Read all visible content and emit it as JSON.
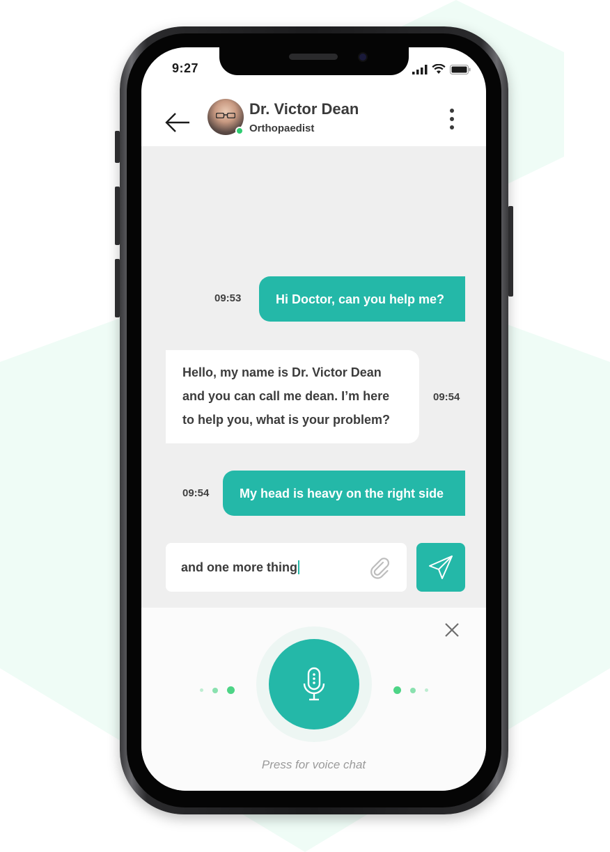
{
  "status_bar": {
    "time": "9:27"
  },
  "header": {
    "doctor_name": "Dr. Victor Dean",
    "doctor_role": "Orthopaedist",
    "online": true
  },
  "messages": [
    {
      "direction": "out",
      "text": "Hi Doctor, can you help me?",
      "time": "09:53"
    },
    {
      "direction": "in",
      "lines": [
        "Hello, my name is Dr. Victor Dean",
        "and you can call me dean. I’m here",
        "to help you, what is your problem?"
      ],
      "time": "09:54"
    },
    {
      "direction": "out",
      "text": "My head is heavy on the right side",
      "time": "09:54"
    }
  ],
  "composer": {
    "value": "and one more thing"
  },
  "voice": {
    "caption": "Press for voice chat"
  },
  "colors": {
    "accent": "#24b8a8",
    "online": "#2ecc71",
    "chat_bg": "#efefef",
    "hex_bg": "#effcf6"
  },
  "icons": {
    "back": "arrow-left-icon",
    "menu": "more-vertical-icon",
    "attach": "paperclip-icon",
    "send": "send-icon",
    "close": "close-icon",
    "mic": "microphone-icon"
  }
}
